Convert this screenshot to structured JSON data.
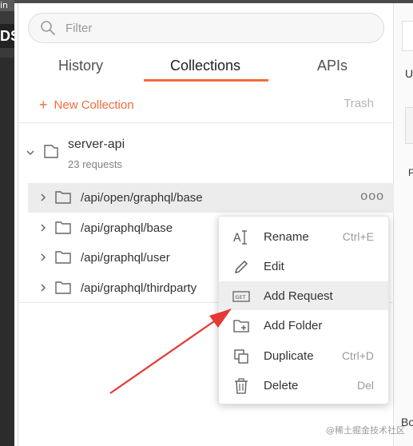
{
  "window": {
    "left_strip_top_text": "in",
    "left_strip_mid_text": "DS"
  },
  "search": {
    "placeholder": "Filter",
    "icon": "search-icon"
  },
  "tabs": [
    {
      "label": "History",
      "active": false
    },
    {
      "label": "Collections",
      "active": true
    },
    {
      "label": "APIs",
      "active": false
    }
  ],
  "actions": {
    "new_collection_plus": "+",
    "new_collection": "New Collection",
    "trash": "Trash"
  },
  "collection": {
    "name": "server-api",
    "count": "23 requests"
  },
  "folders": [
    {
      "name": "/api/open/graphql/base",
      "hover": true,
      "more": "ooo"
    },
    {
      "name": "/api/graphql/base"
    },
    {
      "name": "/api/graphql/user"
    },
    {
      "name": "/api/graphql/thirdparty"
    }
  ],
  "context_menu": {
    "items": [
      {
        "icon": "rename-icon",
        "label": "Rename",
        "shortcut": "Ctrl+E"
      },
      {
        "icon": "edit-icon",
        "label": "Edit",
        "shortcut": ""
      },
      {
        "icon": "add-request-icon",
        "label": "Add Request",
        "shortcut": "",
        "hover": true,
        "icon_text": "GET"
      },
      {
        "icon": "add-folder-icon",
        "label": "Add Folder",
        "shortcut": ""
      },
      {
        "icon": "duplicate-icon",
        "label": "Duplicate",
        "shortcut": "Ctrl+D"
      },
      {
        "icon": "delete-icon",
        "label": "Delete",
        "shortcut": "Del"
      }
    ]
  },
  "right_panel": {
    "text_a": "U",
    "text_b": "P",
    "text_bottom": "Bo"
  },
  "watermark": "@稀土掘金技术社区",
  "colors": {
    "accent": "#f26b3a",
    "annotation_arrow": "#e53935"
  }
}
